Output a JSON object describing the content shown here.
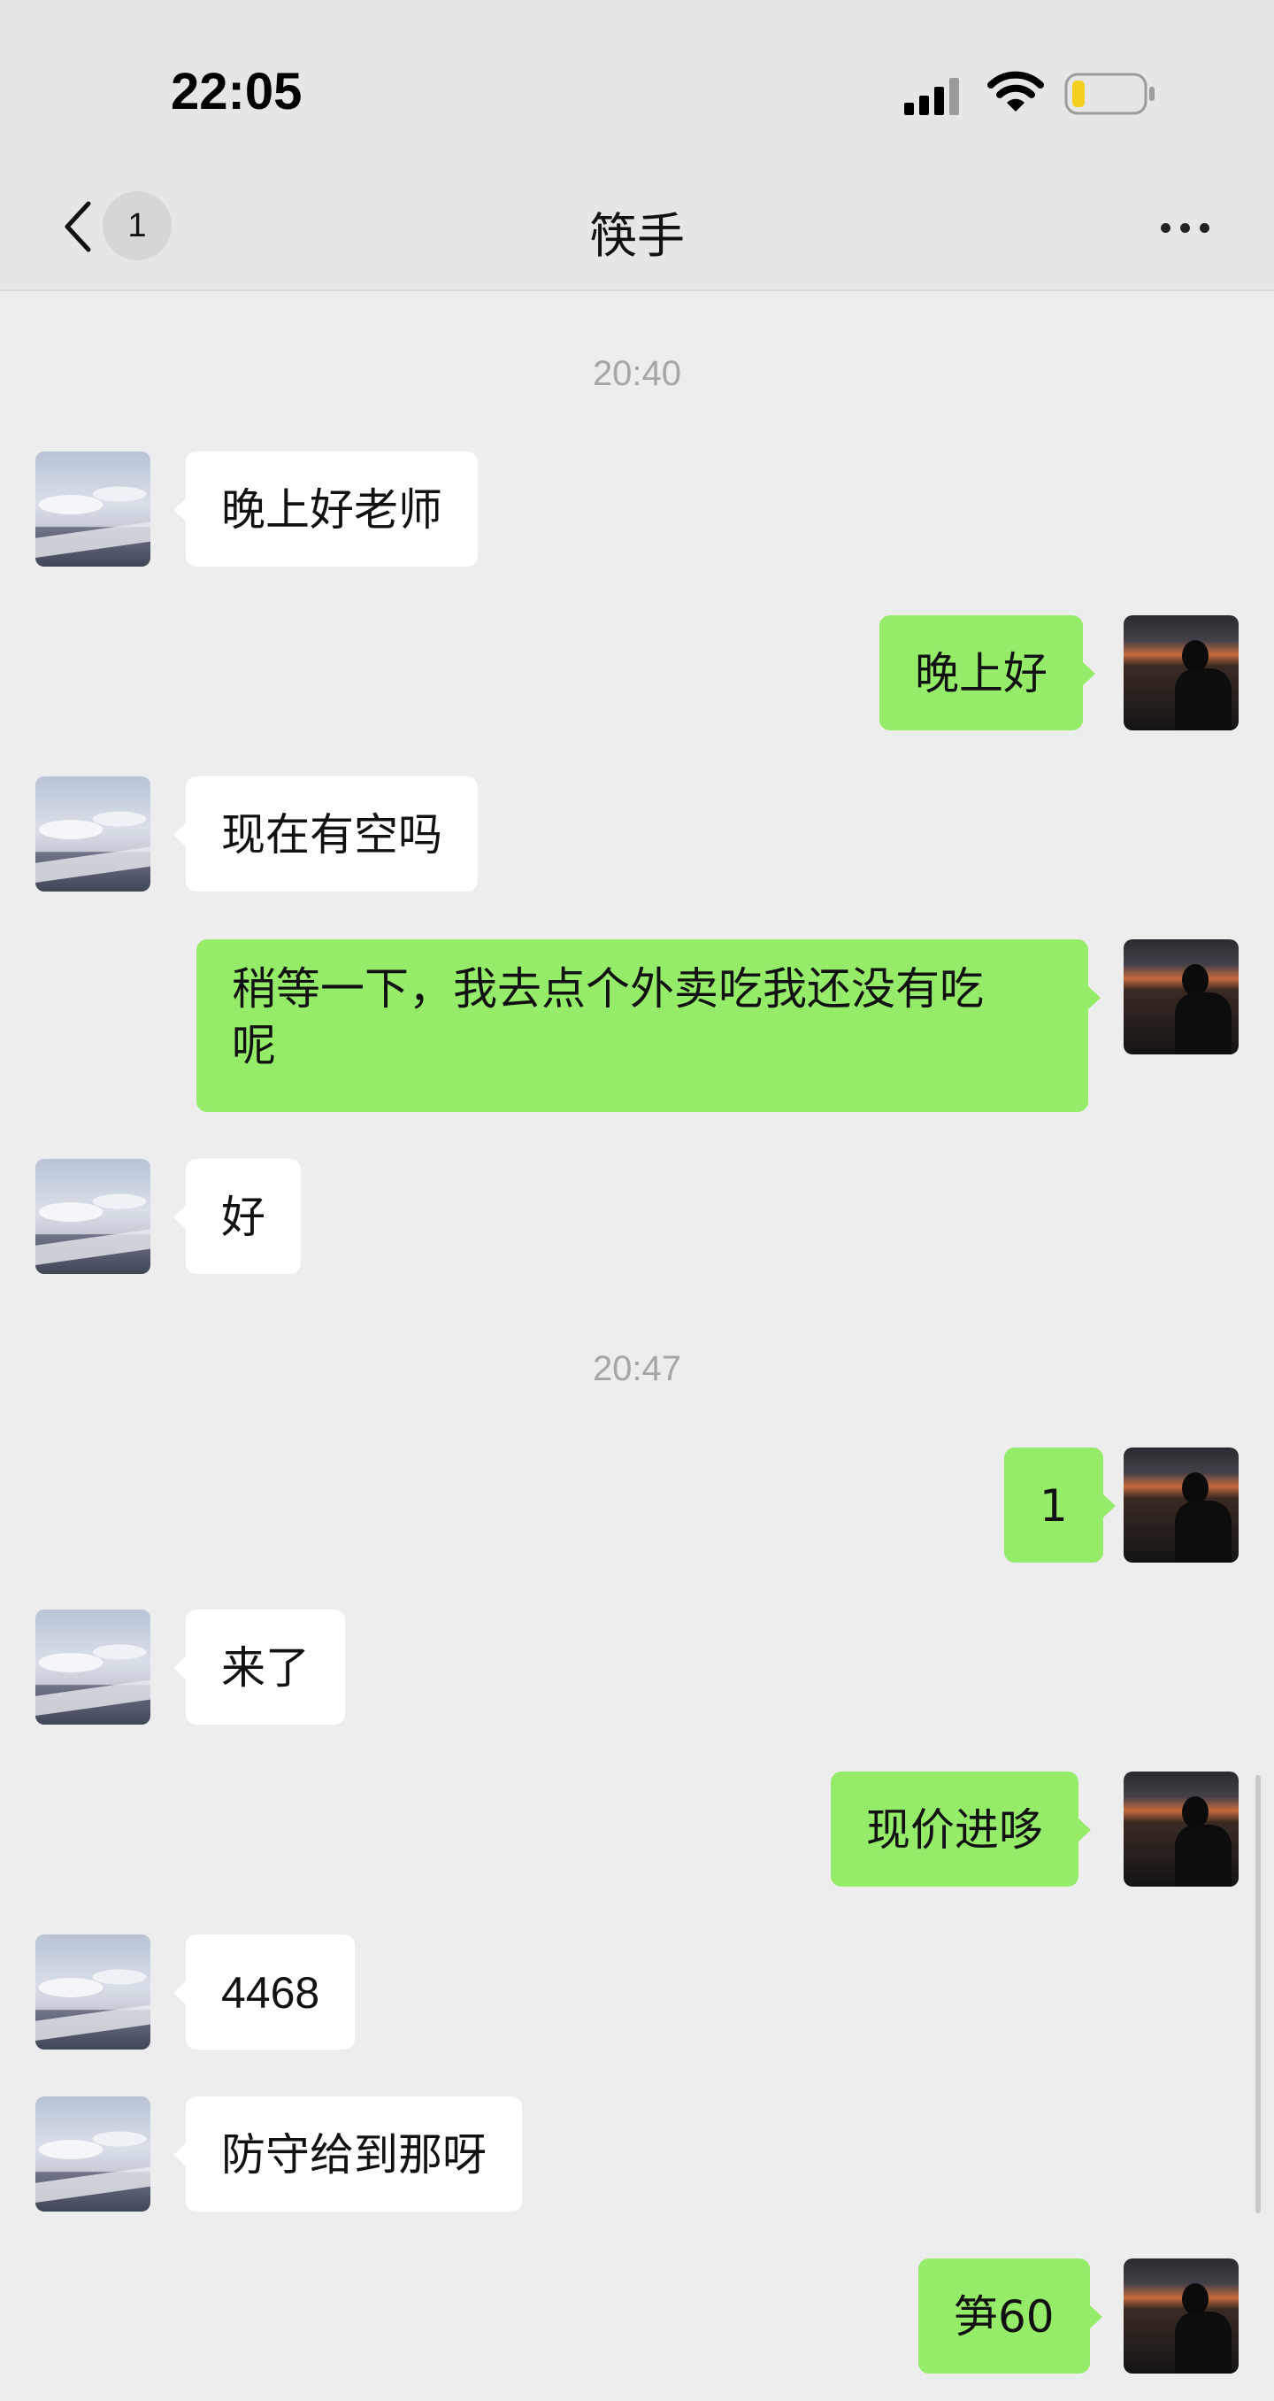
{
  "status_bar": {
    "time": "22:05",
    "icons": [
      "signal-icon",
      "wifi-icon",
      "battery-icon"
    ],
    "battery_color": "#f4d01e"
  },
  "header": {
    "back_badge": "1",
    "title": "筷手",
    "icons": [
      "back-chevron-icon",
      "more-icon"
    ]
  },
  "colors": {
    "background": "#ededed",
    "outgoing_bubble": "#95ec69",
    "incoming_bubble": "#ffffff",
    "time_label": "#a6a6a6"
  },
  "messages": [
    {
      "type": "time",
      "text": "20:40"
    },
    {
      "type": "in",
      "text": "晚上好老师"
    },
    {
      "type": "out",
      "text": "晚上好"
    },
    {
      "type": "in",
      "text": "现在有空吗"
    },
    {
      "type": "out",
      "text": "稍等一下，我去点个外卖吃我还没有吃\n呢"
    },
    {
      "type": "in",
      "text": "好"
    },
    {
      "type": "time",
      "text": "20:47"
    },
    {
      "type": "out",
      "text": "1"
    },
    {
      "type": "in",
      "text": "来了"
    },
    {
      "type": "out",
      "text": "现价进哆"
    },
    {
      "type": "in",
      "text": "4468"
    },
    {
      "type": "in",
      "text": "防守给到那呀"
    },
    {
      "type": "out",
      "text": "笋60"
    }
  ]
}
